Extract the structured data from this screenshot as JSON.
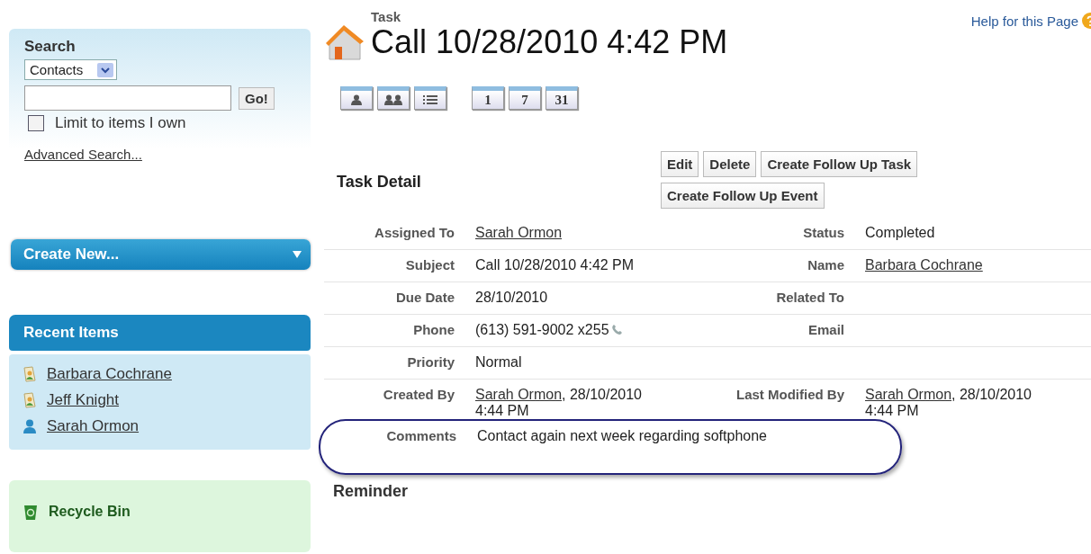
{
  "sidebar": {
    "search": {
      "title": "Search",
      "scope": "Contacts",
      "button": "Go!",
      "limit_label": "Limit to items I own",
      "limit_checked": false,
      "advanced_link": "Advanced Search..."
    },
    "create_new": "Create New...",
    "recent_items": {
      "title": "Recent Items",
      "items": [
        {
          "label": "Barbara Cochrane",
          "kind": "contact"
        },
        {
          "label": "Jeff Knight",
          "kind": "contact"
        },
        {
          "label": "Sarah Ormon",
          "kind": "user"
        }
      ]
    },
    "recycle_bin": "Recycle Bin"
  },
  "header": {
    "type": "Task",
    "title": "Call 10/28/2010 4:42 PM",
    "help_link": "Help for this Page"
  },
  "view_buttons": [
    {
      "kind": "single"
    },
    {
      "kind": "multi"
    },
    {
      "kind": "list"
    }
  ],
  "day_buttons": [
    "1",
    "7",
    "31"
  ],
  "detail": {
    "title": "Task Detail",
    "buttons": [
      "Edit",
      "Delete",
      "Create Follow Up Task",
      "Create Follow Up Event"
    ],
    "rows": [
      {
        "left": {
          "label": "Assigned To",
          "parts": [
            {
              "text": "Sarah Ormon",
              "link": true
            }
          ]
        },
        "right": {
          "label": "Status",
          "parts": [
            {
              "text": "Completed",
              "link": false
            }
          ]
        }
      },
      {
        "left": {
          "label": "Subject",
          "parts": [
            {
              "text": "Call 10/28/2010 4:42 PM",
              "link": false
            }
          ]
        },
        "right": {
          "label": "Name",
          "parts": [
            {
              "text": "Barbara Cochrane",
              "link": true
            }
          ]
        }
      },
      {
        "left": {
          "label": "Due Date",
          "parts": [
            {
              "text": "28/10/2010",
              "link": false
            }
          ]
        },
        "right": {
          "label": "Related To"
        }
      },
      {
        "left": {
          "label": "Phone",
          "parts": [
            {
              "text": "(613) 591-9002 x255",
              "link": false
            }
          ],
          "phone": true
        },
        "right": {
          "label": "Email"
        }
      },
      {
        "left": {
          "label": "Priority",
          "parts": [
            {
              "text": "Normal",
              "link": false
            }
          ]
        }
      },
      {
        "left": {
          "label": "Created By",
          "parts": [
            {
              "text": "Sarah Ormon",
              "link": true
            },
            {
              "text": ", 28/10/2010 4:44 PM",
              "link": false
            }
          ]
        },
        "right": {
          "label": "Last Modified By",
          "parts": [
            {
              "text": "Sarah Ormon",
              "link": true
            },
            {
              "text": ", 28/10/2010 4:44 PM",
              "link": false
            }
          ]
        }
      }
    ],
    "comments": {
      "label": "Comments",
      "value": "Contact again next week regarding softphone",
      "highlighted": true
    }
  },
  "reminder_title": "Reminder"
}
